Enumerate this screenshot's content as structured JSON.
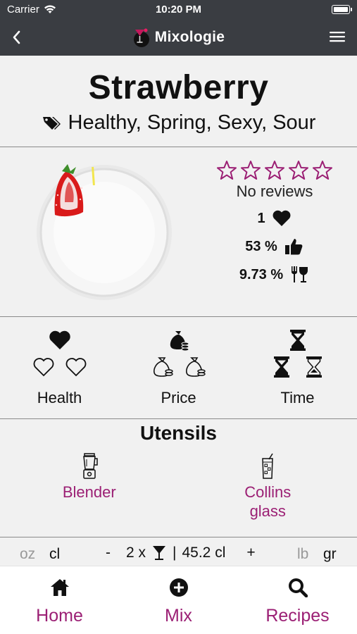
{
  "status_bar": {
    "carrier": "Carrier",
    "time": "10:20 PM"
  },
  "nav": {
    "app_name": "Mixologie"
  },
  "cocktail": {
    "name": "Strawberry",
    "tags": "Healthy, Spring, Sexy, Sour"
  },
  "overview": {
    "stars_filled": 0,
    "stars_total": 5,
    "reviews": "No reviews",
    "likes": "1",
    "approval": "53 %",
    "alcohol": "9.73 %"
  },
  "ratings": {
    "health": {
      "label": "Health",
      "level": 1,
      "max": 3
    },
    "price": {
      "label": "Price",
      "level": 1,
      "max": 3
    },
    "time": {
      "label": "Time",
      "level": 2,
      "max": 3
    }
  },
  "utensils": {
    "title": "Utensils",
    "items": [
      {
        "label": "Blender",
        "icon": "blender-icon"
      },
      {
        "label": "Collins glass",
        "icon": "collins-glass-icon"
      }
    ]
  },
  "units": {
    "oz": "oz",
    "cl": "cl",
    "minus": "-",
    "portion_count": "2 x",
    "separator": "|",
    "volume": "45.2 cl",
    "plus": "+",
    "lb": "lb",
    "gr": "gr"
  },
  "tabs": [
    {
      "label": "Home",
      "icon": "home-icon"
    },
    {
      "label": "Mix",
      "icon": "plus-circle-icon"
    },
    {
      "label": "Recipes",
      "icon": "search-icon"
    }
  ],
  "colors": {
    "accent": "#9b1f74",
    "bar": "#3a3d42",
    "background": "#f1f1f1"
  }
}
